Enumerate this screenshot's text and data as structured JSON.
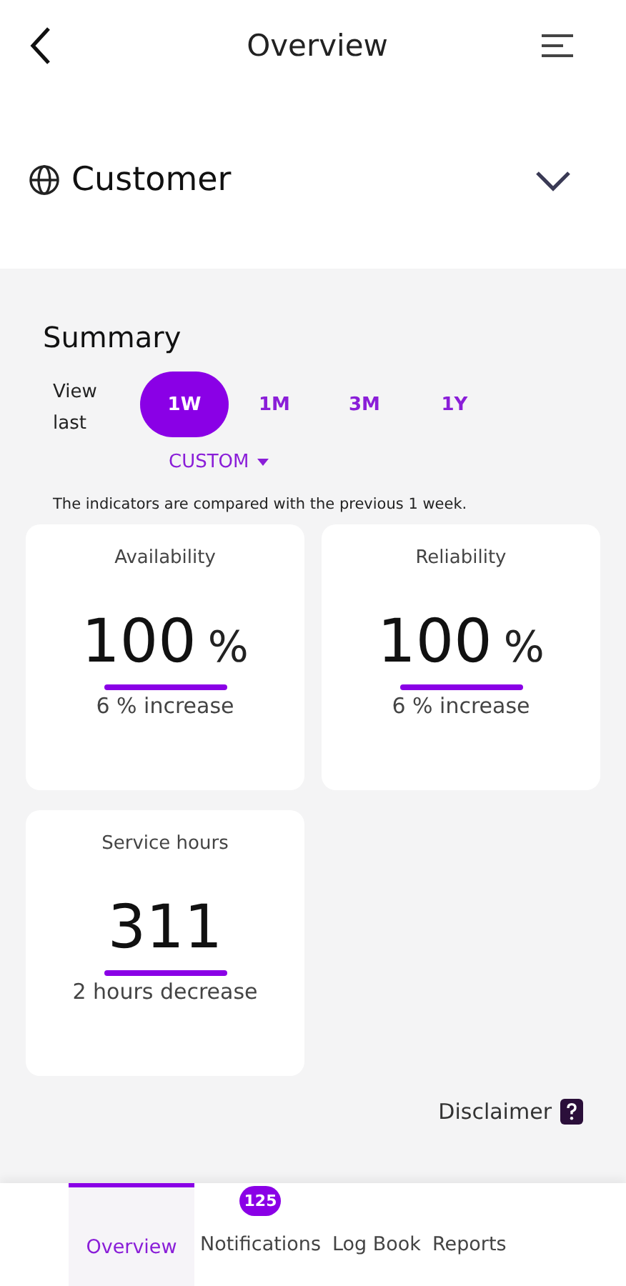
{
  "header": {
    "title": "Overview"
  },
  "site": {
    "name": "Customer",
    "expanded": false
  },
  "summary": {
    "title": "Summary",
    "view_label": "View last",
    "periods": [
      {
        "label": "1W",
        "selected": true
      },
      {
        "label": "1M",
        "selected": false
      },
      {
        "label": "3M",
        "selected": false
      },
      {
        "label": "1Y",
        "selected": false
      }
    ],
    "custom": "CUSTOM",
    "note": "The indicators are compared with the previous 1 week.",
    "metrics": [
      {
        "title": "Availability",
        "value": "100",
        "unit": "%",
        "change": "6 % increase"
      },
      {
        "title": "Reliability",
        "value": "100",
        "unit": "%",
        "change": "6 % increase"
      },
      {
        "title": "Service hours",
        "value": "311",
        "change": "2 hours decrease"
      }
    ],
    "disclaimer": "Disclaimer"
  },
  "nav": [
    {
      "label": "Overview",
      "selected": true
    },
    {
      "label": "Notifications",
      "selected": false,
      "badge": "125"
    },
    {
      "label": "Log Book",
      "selected": false
    },
    {
      "label": "Reports",
      "selected": false
    }
  ]
}
